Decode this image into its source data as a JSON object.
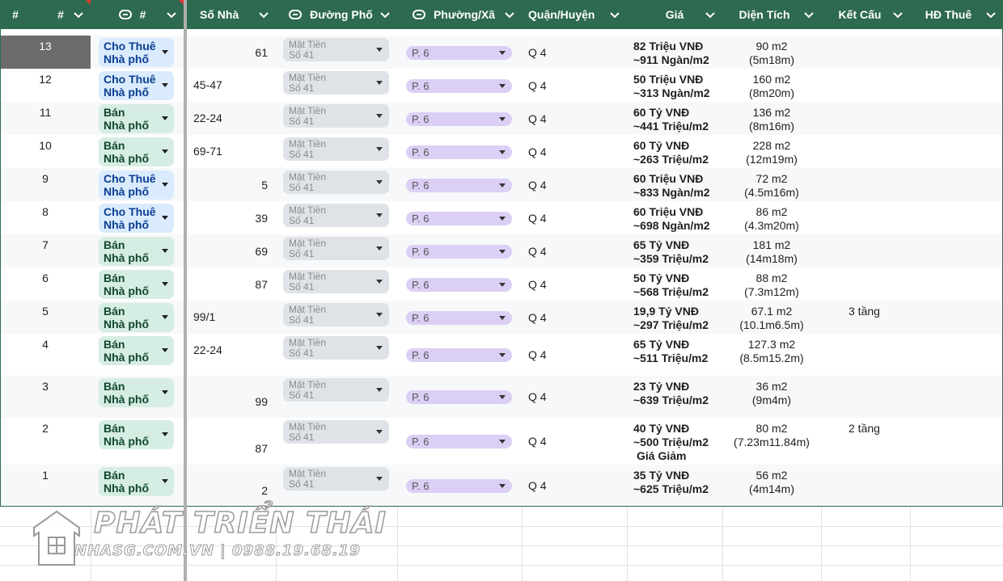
{
  "header": {
    "col_hash1": "#",
    "col_hash2": "#",
    "col_sonha": "Số Nhà",
    "col_duong": "Đường Phố",
    "col_phuong": "Phường/Xã",
    "col_quan": "Quận/Huyện",
    "col_gia": "Giá",
    "col_dientich": "Diện Tích",
    "col_ketcau": "Kết Cấu",
    "col_hdthue": "HĐ Thuê"
  },
  "colors": {
    "header_bg": "#2d6a4f",
    "rent_chip": "#d9ebfd",
    "sale_chip": "#d6ede3",
    "street_chip": "#dfe3e8",
    "ward_chip": "#dccff5"
  },
  "rows": [
    {
      "num": "13",
      "type1": "Cho Thuê",
      "type2": "Nhà phố",
      "sonha": "61",
      "street1": "Mặt Tiền",
      "street2": "Số 41",
      "ward": "P. 6",
      "quan": "Q 4",
      "gia1": "82 Triệu VNĐ",
      "gia2": "~911 Ngàn/m2",
      "gia3": "",
      "dt1": "90 m2",
      "dt2": "(5m18m)",
      "kc": ""
    },
    {
      "num": "12",
      "type1": "Cho Thuê",
      "type2": "Nhà phố",
      "sonha": "45-47",
      "street1": "Mặt Tiền",
      "street2": "Số 41",
      "ward": "P. 6",
      "quan": "Q 4",
      "gia1": "50 Triệu VNĐ",
      "gia2": "~313 Ngàn/m2",
      "gia3": "",
      "dt1": "160 m2",
      "dt2": "(8m20m)",
      "kc": ""
    },
    {
      "num": "11",
      "type1": "Bán",
      "type2": "Nhà phố",
      "sonha": "22-24",
      "street1": "Mặt Tiền",
      "street2": "Số 41",
      "ward": "P. 6",
      "quan": "Q 4",
      "gia1": "60 Tỷ VNĐ",
      "gia2": "~441 Triệu/m2",
      "gia3": "",
      "dt1": "136 m2",
      "dt2": "(8m16m)",
      "kc": ""
    },
    {
      "num": "10",
      "type1": "Bán",
      "type2": "Nhà phố",
      "sonha": "69-71",
      "street1": "Mặt Tiền",
      "street2": "Số 41",
      "ward": "P. 6",
      "quan": "Q 4",
      "gia1": "60 Tỷ VNĐ",
      "gia2": "~263 Triệu/m2",
      "gia3": "",
      "dt1": "228 m2",
      "dt2": "(12m19m)",
      "kc": ""
    },
    {
      "num": "9",
      "type1": "Cho Thuê",
      "type2": "Nhà phố",
      "sonha": "5",
      "street1": "Mặt Tiền",
      "street2": "Số 41",
      "ward": "P. 6",
      "quan": "Q 4",
      "gia1": "60 Triệu VNĐ",
      "gia2": "~833 Ngàn/m2",
      "gia3": "",
      "dt1": "72 m2",
      "dt2": "(4.5m16m)",
      "kc": ""
    },
    {
      "num": "8",
      "type1": "Cho Thuê",
      "type2": "Nhà phố",
      "sonha": "39",
      "street1": "Mặt Tiền",
      "street2": "Số 41",
      "ward": "P. 6",
      "quan": "Q 4",
      "gia1": "60 Triệu VNĐ",
      "gia2": "~698 Ngàn/m2",
      "gia3": "",
      "dt1": "86 m2",
      "dt2": "(4.3m20m)",
      "kc": ""
    },
    {
      "num": "7",
      "type1": "Bán",
      "type2": "Nhà phố",
      "sonha": "69",
      "street1": "Mặt Tiền",
      "street2": "Số 41",
      "ward": "P. 6",
      "quan": "Q 4",
      "gia1": "65 Tỷ VNĐ",
      "gia2": "~359 Triệu/m2",
      "gia3": "",
      "dt1": "181 m2",
      "dt2": "(14m18m)",
      "kc": ""
    },
    {
      "num": "6",
      "type1": "Bán",
      "type2": "Nhà phố",
      "sonha": "87",
      "street1": "Mặt Tiền",
      "street2": "Số 41",
      "ward": "P. 6",
      "quan": "Q 4",
      "gia1": "50 Tỷ VNĐ",
      "gia2": "~568 Triệu/m2",
      "gia3": "",
      "dt1": "88 m2",
      "dt2": "(7.3m12m)",
      "kc": ""
    },
    {
      "num": "5",
      "type1": "Bán",
      "type2": "Nhà phố",
      "sonha": "99/1",
      "street1": "Mặt Tiền",
      "street2": "Số 41",
      "ward": "P. 6",
      "quan": "Q 4",
      "gia1": "19,9 Tỷ VNĐ",
      "gia2": "~297 Triệu/m2",
      "gia3": "",
      "dt1": "67.1 m2",
      "dt2": "(10.1m6.5m)",
      "kc": "3 tầng"
    },
    {
      "num": "4",
      "type1": "Bán",
      "type2": "Nhà phố",
      "sonha": "22-24",
      "street1": "Mặt Tiền",
      "street2": "Số 41",
      "ward": "P. 6",
      "quan": "Q 4",
      "gia1": "65 Tỷ VNĐ",
      "gia2": "~511 Triệu/m2",
      "gia3": "",
      "dt1": "127.3 m2",
      "dt2": "(8.5m15.2m)",
      "kc": ""
    },
    {
      "num": "3",
      "type1": "Bán",
      "type2": "Nhà phố",
      "sonha": "99",
      "street1": "Mặt Tiền",
      "street2": "Số 41",
      "ward": "P. 6",
      "quan": "Q 4",
      "gia1": "23 Tỷ VNĐ",
      "gia2": "~639 Triệu/m2",
      "gia3": "",
      "dt1": "36 m2",
      "dt2": "(9m4m)",
      "kc": ""
    },
    {
      "num": "2",
      "type1": "Bán",
      "type2": "Nhà phố",
      "sonha": "87",
      "street1": "Mặt Tiền",
      "street2": "Số 41",
      "ward": "P. 6",
      "quan": "Q 4",
      "gia1": "40 Tỷ VNĐ",
      "gia2": "~500 Triệu/m2",
      "gia3": "Giá Giảm",
      "dt1": "80 m2",
      "dt2": "(7.23m11.84m)",
      "kc": "2 tầng"
    },
    {
      "num": "1",
      "type1": "Bán",
      "type2": "Nhà phố",
      "sonha": "2",
      "street1": "Mặt Tiền",
      "street2": "Số 41",
      "ward": "P. 6",
      "quan": "Q 4",
      "gia1": "35 Tỷ VNĐ",
      "gia2": "~625 Triệu/m2",
      "gia3": "",
      "dt1": "56 m2",
      "dt2": "(4m14m)",
      "kc": ""
    }
  ],
  "watermark": {
    "brand": "PHÁT TRIỂN THÁI",
    "sub": "NHASG.COM.VN | 0988.19.68.19"
  }
}
